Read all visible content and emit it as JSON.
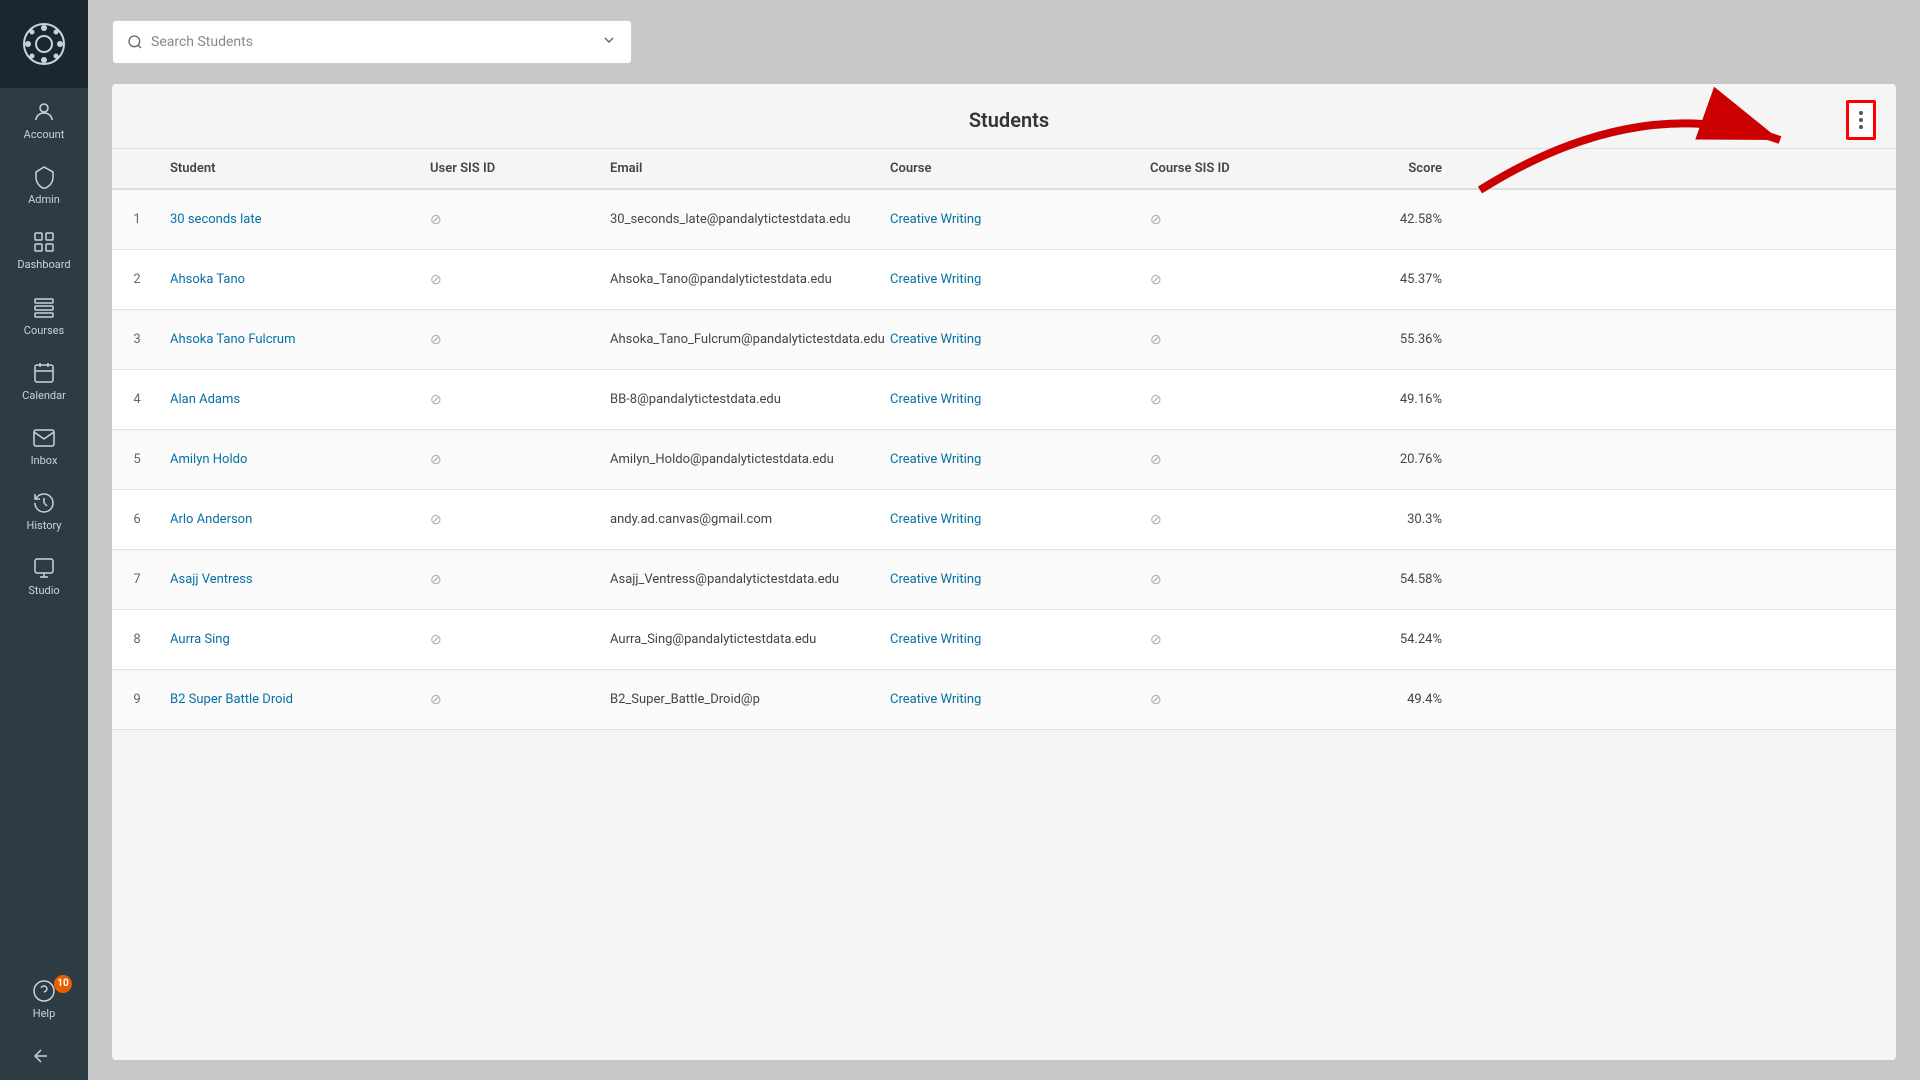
{
  "sidebar": {
    "logo_alt": "Canvas Logo",
    "items": [
      {
        "id": "account",
        "label": "Account",
        "icon": "account"
      },
      {
        "id": "admin",
        "label": "Admin",
        "icon": "admin"
      },
      {
        "id": "dashboard",
        "label": "Dashboard",
        "icon": "dashboard"
      },
      {
        "id": "courses",
        "label": "Courses",
        "icon": "courses"
      },
      {
        "id": "calendar",
        "label": "Calendar",
        "icon": "calendar"
      },
      {
        "id": "inbox",
        "label": "Inbox",
        "icon": "inbox"
      },
      {
        "id": "history",
        "label": "History",
        "icon": "history"
      },
      {
        "id": "studio",
        "label": "Studio",
        "icon": "studio"
      },
      {
        "id": "help",
        "label": "Help",
        "icon": "help",
        "badge": "10"
      }
    ],
    "collapse_label": "Collapse"
  },
  "search": {
    "placeholder": "Search Students",
    "chevron": "▾"
  },
  "table": {
    "title": "Students",
    "columns": [
      "Student",
      "User SIS ID",
      "Email",
      "Course",
      "Course SIS ID",
      "Score"
    ],
    "rows": [
      {
        "num": 1,
        "student": "30 seconds late",
        "user_sis_id": "",
        "email": "30_seconds_late@pandalytictestdata.edu",
        "course": "Creative Writing",
        "course_sis_id": "",
        "score": "42.58%"
      },
      {
        "num": 2,
        "student": "Ahsoka Tano",
        "user_sis_id": "",
        "email": "Ahsoka_Tano@pandalytictestdata.edu",
        "course": "Creative Writing",
        "course_sis_id": "",
        "score": "45.37%"
      },
      {
        "num": 3,
        "student": "Ahsoka Tano Fulcrum",
        "user_sis_id": "",
        "email": "Ahsoka_Tano_Fulcrum@pandalytictestdata.edu",
        "course": "Creative Writing",
        "course_sis_id": "",
        "score": "55.36%"
      },
      {
        "num": 4,
        "student": "Alan Adams",
        "user_sis_id": "",
        "email": "BB-8@pandalytictestdata.edu",
        "course": "Creative Writing",
        "course_sis_id": "",
        "score": "49.16%"
      },
      {
        "num": 5,
        "student": "Amilyn Holdo",
        "user_sis_id": "",
        "email": "Amilyn_Holdo@pandalytictestdata.edu",
        "course": "Creative Writing",
        "course_sis_id": "",
        "score": "20.76%"
      },
      {
        "num": 6,
        "student": "Arlo Anderson",
        "user_sis_id": "",
        "email": "andy.ad.canvas@gmail.com",
        "course": "Creative Writing",
        "course_sis_id": "",
        "score": "30.3%"
      },
      {
        "num": 7,
        "student": "Asajj Ventress",
        "user_sis_id": "",
        "email": "Asajj_Ventress@pandalytictestdata.edu",
        "course": "Creative Writing",
        "course_sis_id": "",
        "score": "54.58%"
      },
      {
        "num": 8,
        "student": "Aurra Sing",
        "user_sis_id": "",
        "email": "Aurra_Sing@pandalytictestdata.edu",
        "course": "Creative Writing",
        "course_sis_id": "",
        "score": "54.24%"
      },
      {
        "num": 9,
        "student": "B2 Super Battle Droid",
        "user_sis_id": "",
        "email": "B2_Super_Battle_Droid@p",
        "course": "Creative Writing",
        "course_sis_id": "",
        "score": "49.4%"
      }
    ]
  },
  "annotation": {
    "arrow_color": "#cc0000",
    "highlight_button": "⋮"
  }
}
